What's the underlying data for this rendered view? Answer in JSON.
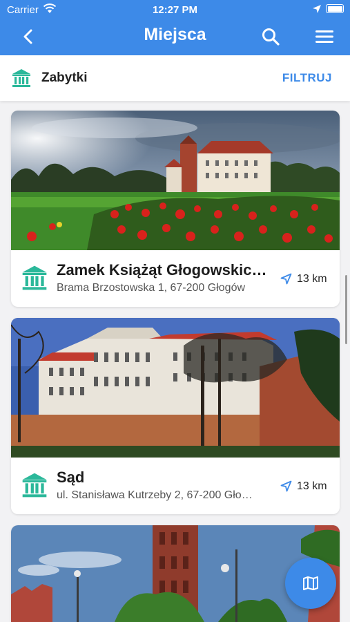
{
  "status_bar": {
    "carrier": "Carrier",
    "time": "12:27 PM"
  },
  "header": {
    "title": "Miejsca",
    "back_icon": "chevron-left-icon",
    "search_icon": "search-icon",
    "menu_icon": "hamburger-menu-icon"
  },
  "filter_bar": {
    "category_icon": "monument-icon",
    "category_label": "Zabytki",
    "filter_label": "FILTRUJ"
  },
  "colors": {
    "accent": "#3d8ae8",
    "category_icon": "#2bb89a",
    "distance_icon": "#3d8ae8"
  },
  "places": [
    {
      "name": "Zamek Książąt Głogowskich…",
      "address": "Brama Brzostowska 1, 67-200 Głogów",
      "distance": "13 km",
      "icon": "monument-icon"
    },
    {
      "name": "Sąd",
      "address": "ul. Stanisława Kutrzeby 2, 67-200 Gło…",
      "distance": "13 km",
      "icon": "monument-icon"
    }
  ],
  "fab": {
    "icon": "map-icon"
  }
}
